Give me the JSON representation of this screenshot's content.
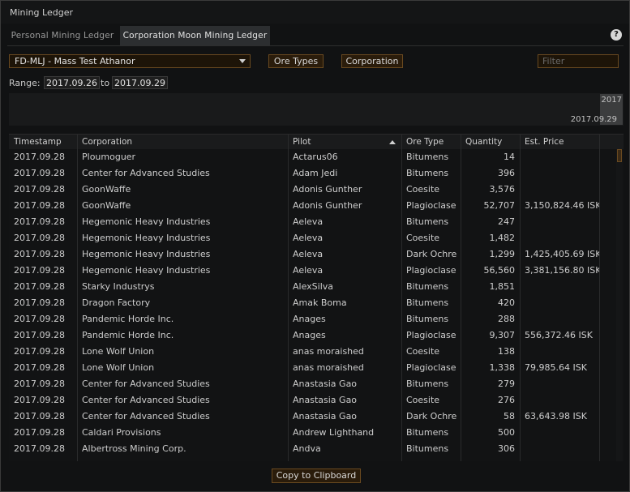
{
  "window": {
    "title": "Mining Ledger"
  },
  "tabs": [
    {
      "label": "Personal Mining Ledger",
      "active": false
    },
    {
      "label": "Corporation Moon Mining Ledger",
      "active": true
    }
  ],
  "help_label": "?",
  "structure_select": {
    "value": "FD-MLJ - Mass Test Athanor"
  },
  "buttons": {
    "ore_types": "Ore Types",
    "corporation": "Corporation",
    "copy": "Copy to Clipboard"
  },
  "filter": {
    "placeholder": "Filter"
  },
  "range": {
    "label": "Range:",
    "from": "2017.09.26",
    "to_label": "to",
    "to": "2017.09.29"
  },
  "timeline": {
    "year": "2017",
    "date": "2017.09.29"
  },
  "table": {
    "columns": [
      "Timestamp",
      "Corporation",
      "Pilot",
      "Ore Type",
      "Quantity",
      "Est. Price"
    ],
    "rows": [
      [
        "2017.09.28",
        "Ploumoguer",
        "Actarus06",
        "Bitumens",
        "14",
        ""
      ],
      [
        "2017.09.28",
        "Center for Advanced Studies",
        "Adam Jedi",
        "Bitumens",
        "396",
        ""
      ],
      [
        "2017.09.28",
        "GoonWaffe",
        "Adonis Gunther",
        "Coesite",
        "3,576",
        ""
      ],
      [
        "2017.09.28",
        "GoonWaffe",
        "Adonis Gunther",
        "Plagioclase",
        "52,707",
        "3,150,824.46 ISK"
      ],
      [
        "2017.09.28",
        "Hegemonic Heavy Industries",
        "Aeleva",
        "Bitumens",
        "247",
        ""
      ],
      [
        "2017.09.28",
        "Hegemonic Heavy Industries",
        "Aeleva",
        "Coesite",
        "1,482",
        ""
      ],
      [
        "2017.09.28",
        "Hegemonic Heavy Industries",
        "Aeleva",
        "Dark Ochre",
        "1,299",
        "1,425,405.69 ISK"
      ],
      [
        "2017.09.28",
        "Hegemonic Heavy Industries",
        "Aeleva",
        "Plagioclase",
        "56,560",
        "3,381,156.80 ISK"
      ],
      [
        "2017.09.28",
        "Starky Industrys",
        "AlexSilva",
        "Bitumens",
        "1,851",
        ""
      ],
      [
        "2017.09.28",
        "Dragon Factory",
        "Amak Boma",
        "Bitumens",
        "420",
        ""
      ],
      [
        "2017.09.28",
        "Pandemic Horde Inc.",
        "Anages",
        "Bitumens",
        "288",
        ""
      ],
      [
        "2017.09.28",
        "Pandemic Horde Inc.",
        "Anages",
        "Plagioclase",
        "9,307",
        "556,372.46 ISK"
      ],
      [
        "2017.09.28",
        "Lone Wolf Union",
        "anas moraished",
        "Coesite",
        "138",
        ""
      ],
      [
        "2017.09.28",
        "Lone Wolf Union",
        "anas moraished",
        "Plagioclase",
        "1,338",
        "79,985.64 ISK"
      ],
      [
        "2017.09.28",
        "Center for Advanced Studies",
        "Anastasia Gao",
        "Bitumens",
        "279",
        ""
      ],
      [
        "2017.09.28",
        "Center for Advanced Studies",
        "Anastasia Gao",
        "Coesite",
        "276",
        ""
      ],
      [
        "2017.09.28",
        "Center for Advanced Studies",
        "Anastasia Gao",
        "Dark Ochre",
        "58",
        "63,643.98 ISK"
      ],
      [
        "2017.09.28",
        "Caldari Provisions",
        "Andrew Lighthand",
        "Bitumens",
        "500",
        ""
      ],
      [
        "2017.09.28",
        "Albertross Mining Corp.",
        "Andva",
        "Bitumens",
        "306",
        ""
      ]
    ]
  }
}
